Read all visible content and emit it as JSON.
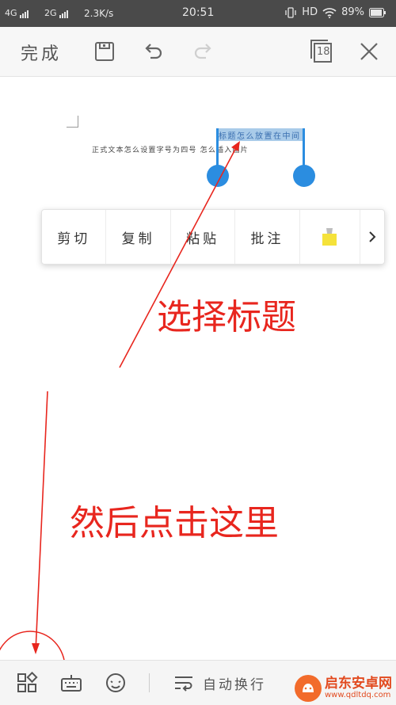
{
  "status_bar": {
    "net1": "4G",
    "net2": "2G",
    "speed": "2.3K/s",
    "time": "20:51",
    "hd": "HD",
    "battery": "89%"
  },
  "toolbar": {
    "done_label": "完成",
    "page_count": "18",
    "icons": [
      "save-icon",
      "undo-icon",
      "redo-icon",
      "pages-icon",
      "close-icon"
    ]
  },
  "document": {
    "selected_title": "标题怎么放置在中间",
    "body_line": "正式文本怎么设置字号为四号 怎么插入图片"
  },
  "context_menu": {
    "items": [
      "剪切",
      "复制",
      "粘贴",
      "批注"
    ],
    "icons": [
      "highlighter-icon",
      "chevron-right-icon"
    ],
    "highlight_color": "#f5e23a"
  },
  "annotations": {
    "select_title": "选择标题",
    "then_click": "然后点击这里",
    "color": "#e8261e"
  },
  "bottom_bar": {
    "wrap_label": "自动换行",
    "icons": [
      "grid-icon",
      "keyboard-icon",
      "smiley-icon",
      "wrap-text-icon"
    ]
  },
  "watermark": {
    "name": "启东安卓网",
    "url": "www.qdltdq.com"
  }
}
